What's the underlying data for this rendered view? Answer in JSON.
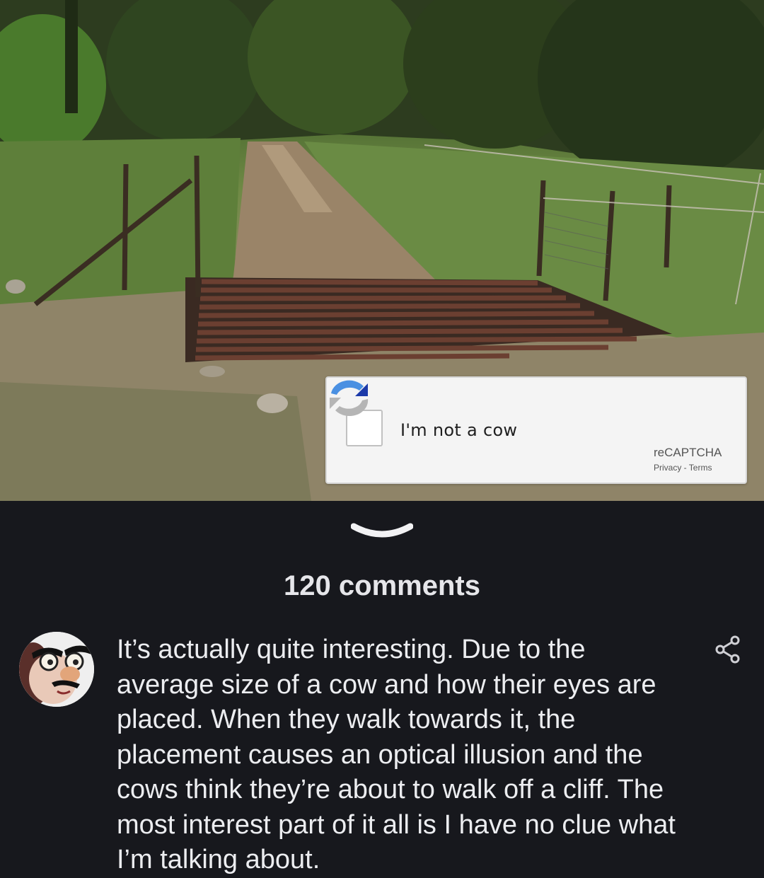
{
  "captcha": {
    "label": "I'm not a cow",
    "brand": "reCAPTCHA",
    "privacy": "Privacy",
    "separator": " - ",
    "terms": "Terms",
    "checked": false,
    "logo_icon": "recaptcha-logo-icon"
  },
  "photo": {
    "subject": "cattle-grid-on-dirt-road"
  },
  "collapse_icon": "chevron-down-icon",
  "comments": {
    "count_label": "120 comments",
    "items": [
      {
        "avatar_icon": "groucho-glasses-avatar",
        "text": "It’s actually quite interesting. Due to the average size of a cow and how their eyes are placed. When they walk towards it, the placement causes an optical illusion and the cows think they’re about to walk off a cliff. The most interest part of it all is I have no clue what I’m talking about.",
        "share_icon": "share-icon"
      }
    ]
  },
  "colors": {
    "background": "#17181d",
    "text": "#ecedf0",
    "captcha_bg": "#f4f4f4",
    "recaptcha_blue": "#4a90e2",
    "recaptcha_gray": "#b5b5b5"
  }
}
